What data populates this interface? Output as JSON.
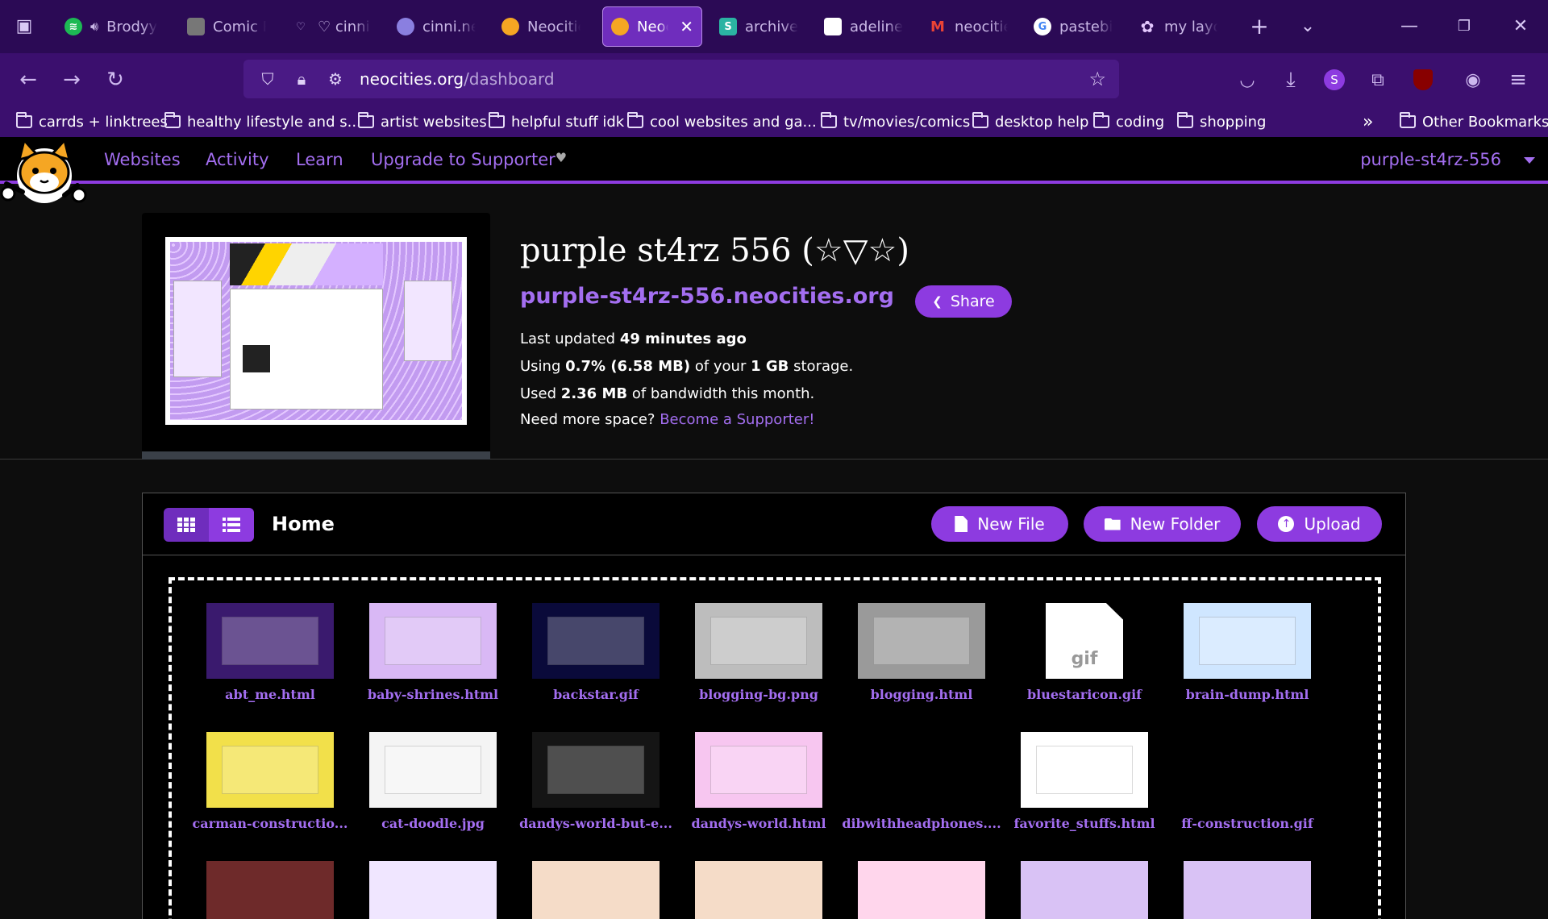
{
  "browser": {
    "tabs": [
      {
        "title": "Brodyy",
        "icon": "spotify-icon",
        "color": "#1db954"
      },
      {
        "title": "Comic Reader",
        "icon": "comic-icon",
        "color": "#888888"
      },
      {
        "title": "♡ cinni's",
        "icon": "cinni-icon",
        "color": "#b19cd9"
      },
      {
        "title": "cinni.net",
        "icon": "cinninet-icon",
        "color": "#8a7fe0"
      },
      {
        "title": "Neocities",
        "icon": "neocities-icon",
        "color": "#f5a623"
      },
      {
        "title": "Neoci",
        "icon": "neocities-icon",
        "color": "#f5a623"
      },
      {
        "title": "archived",
        "icon": "archive-icon",
        "color": "#2bb3a3"
      },
      {
        "title": "adeline.r",
        "icon": "page-icon",
        "color": "#ffffff"
      },
      {
        "title": "neocities",
        "icon": "gmail-icon",
        "color": "#ea4335"
      },
      {
        "title": "pastebin",
        "icon": "google-icon",
        "color": "#4285f4"
      },
      {
        "title": "my layou",
        "icon": "flower-icon",
        "color": "#d9b8f5"
      }
    ],
    "url_host": "neocities.org",
    "url_path": "/dashboard",
    "bookmarks": [
      "carrds + linktrees",
      "healthy lifestyle and s...",
      "artist websites",
      "helpful stuff idk",
      "cool websites and ga...",
      "tv/movies/comics",
      "desktop help",
      "coding",
      "shopping"
    ],
    "other_bookmarks": "Other Bookmarks",
    "profile_initial": "S"
  },
  "site_nav": {
    "links": [
      "Websites",
      "Activity",
      "Learn",
      "Upgrade to Supporter"
    ],
    "username": "purple-st4rz-556"
  },
  "site": {
    "title": "purple st4rz 556 (☆▽☆)",
    "url": "purple-st4rz-556.neocities.org",
    "share": "Share",
    "last_updated_label": "Last updated",
    "last_updated": "49 minutes ago",
    "using_label": "Using",
    "using": "0.7% (6.58 MB)",
    "of_your": "of your",
    "quota": "1 GB",
    "storage": "storage.",
    "used_label": "Used",
    "bandwidth": "2.36 MB",
    "bandwidth_suffix": "of bandwidth this month.",
    "need_space": "Need more space?",
    "become_supporter": "Become a Supporter!"
  },
  "files_panel": {
    "crumb": "Home",
    "new_file": "New File",
    "new_folder": "New Folder",
    "upload": "Upload",
    "files": [
      {
        "name": "abt_me.html",
        "color": "#3a1a6e"
      },
      {
        "name": "baby-shrines.html",
        "color": "#d9b8f5"
      },
      {
        "name": "backstar.gif",
        "color": "#0a0a3a"
      },
      {
        "name": "blogging-bg.png",
        "color": "#bdbdbd"
      },
      {
        "name": "blogging.html",
        "color": "#9a9a9a"
      },
      {
        "name": "bluestaricon.gif",
        "color": "#ffffff"
      },
      {
        "name": "brain-dump.html",
        "color": "#cfe6ff"
      },
      {
        "name": "carman-constructio...",
        "color": "#f2e04a"
      },
      {
        "name": "cat-doodle.jpg",
        "color": "#f4f4f4"
      },
      {
        "name": "dandys-world-but-e...",
        "color": "#151515"
      },
      {
        "name": "dandys-world.html",
        "color": "#f7c6f0"
      },
      {
        "name": "dibwithheadphones....",
        "color": "#000000"
      },
      {
        "name": "favorite_stuffs.html",
        "color": "#ffffff"
      },
      {
        "name": "ff-construction.gif",
        "color": "#000000"
      },
      {
        "name": "",
        "color": "#6e2a2a"
      },
      {
        "name": "",
        "color": "#f0e6ff"
      },
      {
        "name": "",
        "color": "#f5dcc8"
      },
      {
        "name": "",
        "color": "#f5dcc8"
      },
      {
        "name": "",
        "color": "#ffd6ec"
      },
      {
        "name": "",
        "color": "#d9c2f5"
      },
      {
        "name": "",
        "color": "#d9c2f5"
      }
    ],
    "gif_label": "gif"
  }
}
